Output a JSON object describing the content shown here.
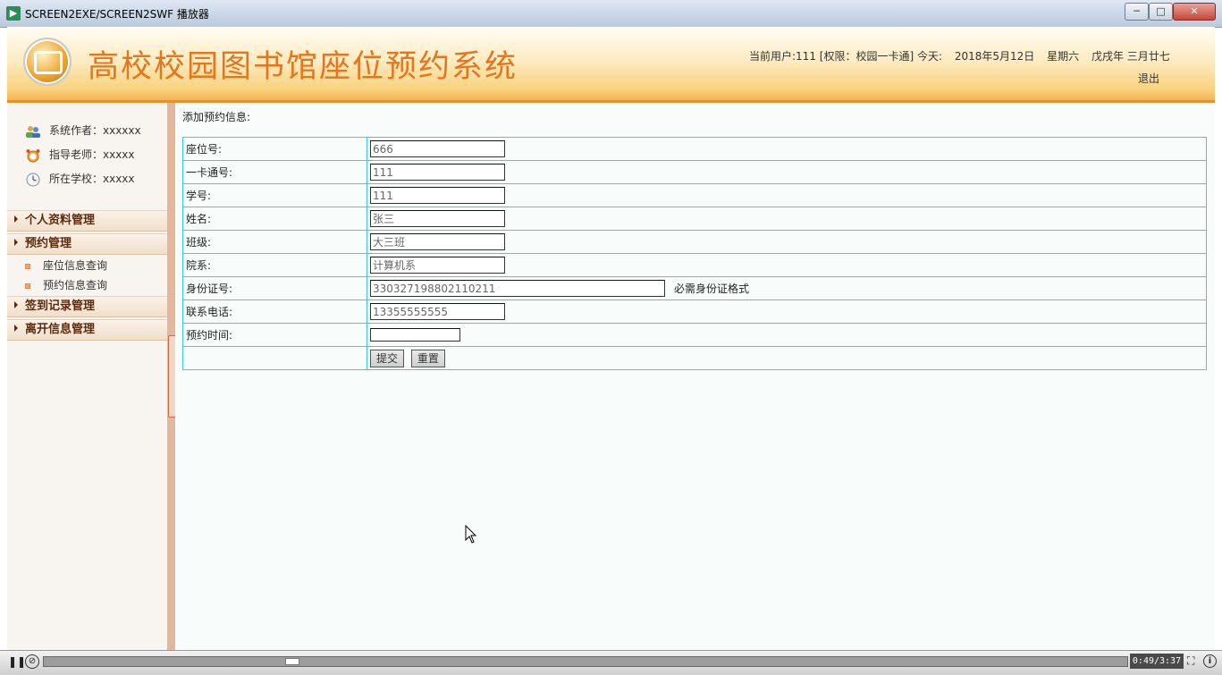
{
  "window": {
    "title": "SCREEN2EXE/SCREEN2SWF 播放器",
    "min_glyph": "─",
    "max_glyph": "□",
    "close_glyph": "✕"
  },
  "header": {
    "app_title": "高校校园图书馆座位预约系统",
    "user_info": [
      "当前用户:111 [权限：校园一卡通] 今天:",
      "2018年5月12日",
      "星期六",
      "戊戌年 三月廿七"
    ],
    "logout": "退出"
  },
  "sidebar": {
    "info": [
      {
        "label": "系统作者：xxxxxx",
        "icon": "people-icon"
      },
      {
        "label": "指导老师：xxxxx",
        "icon": "alarm-clock-icon"
      },
      {
        "label": "所在学校：xxxxx",
        "icon": "clock-icon"
      }
    ],
    "menus": [
      {
        "label": "个人资料管理"
      },
      {
        "label": "预约管理",
        "items": [
          "座位信息查询",
          "预约信息查询"
        ]
      },
      {
        "label": "签到记录管理"
      },
      {
        "label": "离开信息管理"
      }
    ]
  },
  "form": {
    "heading": "添加预约信息:",
    "fields": [
      {
        "label": "座位号:",
        "value": "666"
      },
      {
        "label": "一卡通号:",
        "value": "111"
      },
      {
        "label": "学号:",
        "value": "111"
      },
      {
        "label": "姓名:",
        "value": "张三"
      },
      {
        "label": "班级:",
        "value": "大三班"
      },
      {
        "label": "院系:",
        "value": "计算机系"
      },
      {
        "label": "身份证号:",
        "value": "330327198802110211",
        "hint": "必需身份证格式"
      },
      {
        "label": "联系电话:",
        "value": "13355555555"
      },
      {
        "label": "预约时间:",
        "value": ""
      }
    ],
    "submit_label": "提交",
    "reset_label": "重置"
  },
  "player": {
    "time": "0:49/3:37",
    "progress": 0.2258,
    "pause_glyph": "❚❚",
    "loop_glyph": "⊘",
    "fullscreen_glyph": "⛶",
    "about_glyph": "i"
  }
}
